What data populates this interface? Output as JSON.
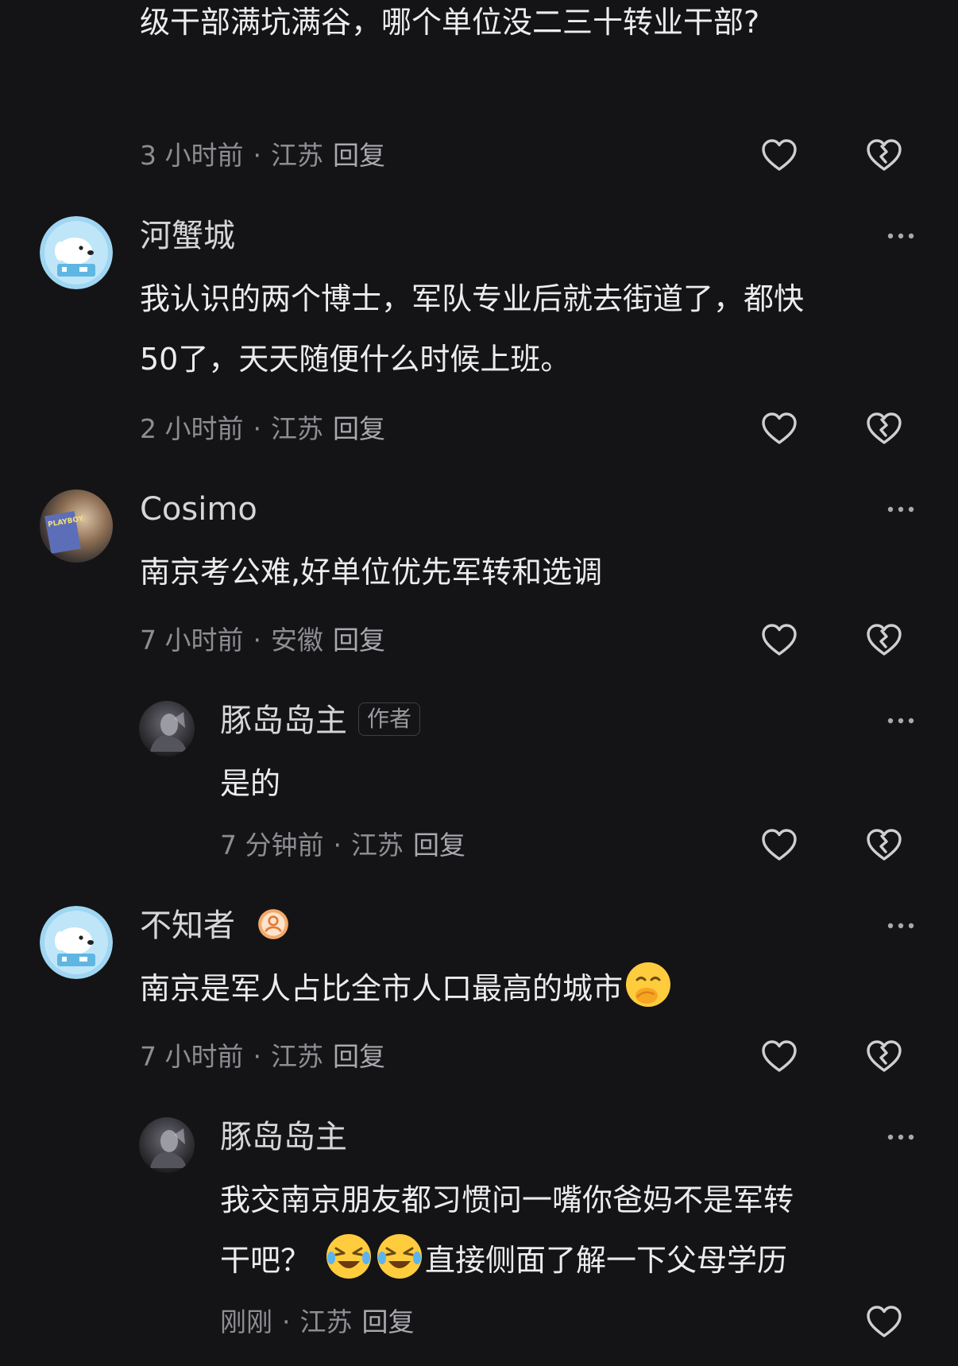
{
  "comments": [
    {
      "text_lines": [
        "级干部满坑满谷，哪个单位没二三十转业干部?"
      ],
      "time": "3 小时前",
      "location": "江苏",
      "reply_label": "回复"
    },
    {
      "username": "河蟹城",
      "text_lines": [
        "我认识的两个博士，军队专业后就去街道了，都快",
        "50了，天天随便什么时候上班。"
      ],
      "time": "2 小时前",
      "location": "江苏",
      "reply_label": "回复"
    },
    {
      "username": "Cosimo",
      "avatar_text": "PLAYBOY",
      "text_lines": [
        "南京考公难,好单位优先军转和选调"
      ],
      "time": "7 小时前",
      "location": "安徽",
      "reply_label": "回复"
    },
    {
      "username": "豚岛岛主",
      "badge": "作者",
      "text_lines": [
        "是的"
      ],
      "time": "7 分钟前",
      "location": "江苏",
      "reply_label": "回复"
    },
    {
      "username": "不知者",
      "text_lines": [
        "南京是军人占比全市人口最高的城市"
      ],
      "time": "7 小时前",
      "location": "江苏",
      "reply_label": "回复"
    },
    {
      "username": "豚岛岛主",
      "text_lines": [
        "我交南京朋友都习惯问一嘴你爸妈不是军转",
        "干吧？",
        "直接侧面了解一下父母学历"
      ],
      "time": "刚刚",
      "location": "江苏",
      "reply_label": "回复"
    }
  ],
  "meta_separator": "·",
  "colors": {
    "background": "#141416",
    "text": "#ececee",
    "meta": "#8d8d92",
    "icon": "#cfcfd3"
  }
}
